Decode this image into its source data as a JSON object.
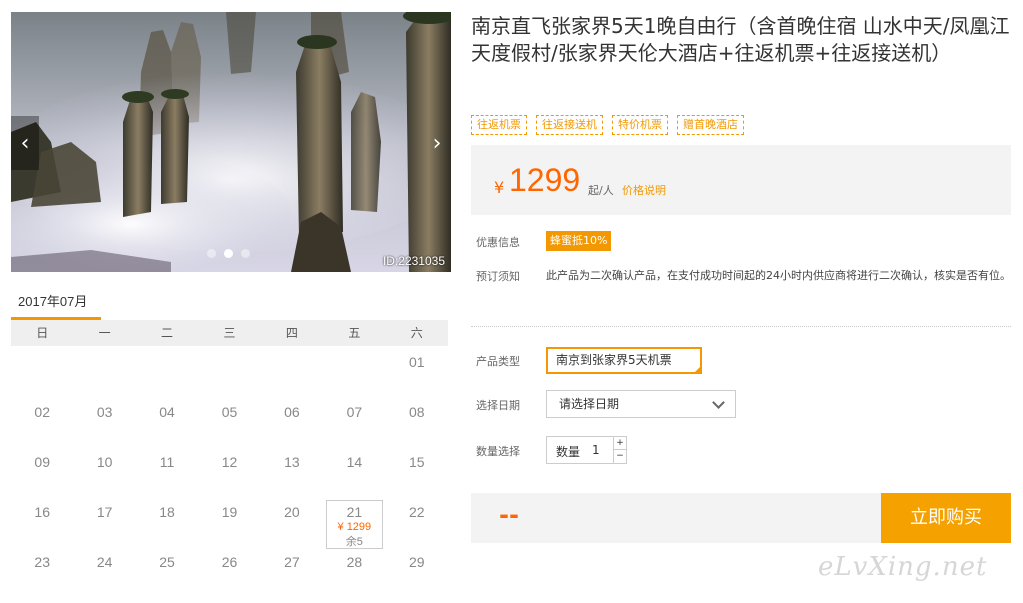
{
  "gallery": {
    "image_id": "ID:2231035",
    "prev_glyph": "‹",
    "next_glyph": "›",
    "dots_count": 3,
    "active_dot": 1
  },
  "calendar": {
    "month": "2017年07月",
    "weekdays": [
      "日",
      "一",
      "二",
      "三",
      "四",
      "五",
      "六"
    ],
    "rows": [
      [
        "",
        "",
        "",
        "",
        "",
        "",
        "01"
      ],
      [
        "02",
        "03",
        "04",
        "05",
        "06",
        "07",
        "08"
      ],
      [
        "09",
        "10",
        "11",
        "12",
        "13",
        "14",
        "15"
      ],
      [
        "16",
        "17",
        "18",
        "19",
        "20",
        "21",
        "22"
      ],
      [
        "23",
        "24",
        "25",
        "26",
        "27",
        "28",
        "29"
      ]
    ],
    "available": {
      "day": "21",
      "price": "¥ 1299",
      "remaining": "余5"
    }
  },
  "product": {
    "title": "南京直飞张家界5天1晚自由行（含首晚住宿 山水中天/凤凰江天度假村/张家界天伦大酒店+往返机票+往返接送机）",
    "tags": [
      "往返机票",
      "往返接送机",
      "特价机票",
      "赠首晚酒店"
    ],
    "price": {
      "currency": "¥",
      "amount": "1299",
      "unit": "起/人",
      "explain_link": "价格说明"
    },
    "promo_label": "优惠信息",
    "promo_badge": "蜂蜜抵10%",
    "notice_label": "预订须知",
    "notice_text": "此产品为二次确认产品，在支付成功时间起的24小时内供应商将进行二次确认，核实是否有位。",
    "type_label": "产品类型",
    "type_value": "南京到张家界5天机票",
    "date_label": "选择日期",
    "date_placeholder": "请选择日期",
    "qty_label": "数量选择",
    "qty_inner_label": "数量",
    "qty_value": "1",
    "qty_plus": "+",
    "qty_minus": "−",
    "total_display": "--",
    "buy_button": "立即购买"
  },
  "watermark": "eLvXing.net",
  "colors": {
    "accent": "#f39800",
    "price": "#ff6600",
    "buy_button": "#f5a100"
  }
}
